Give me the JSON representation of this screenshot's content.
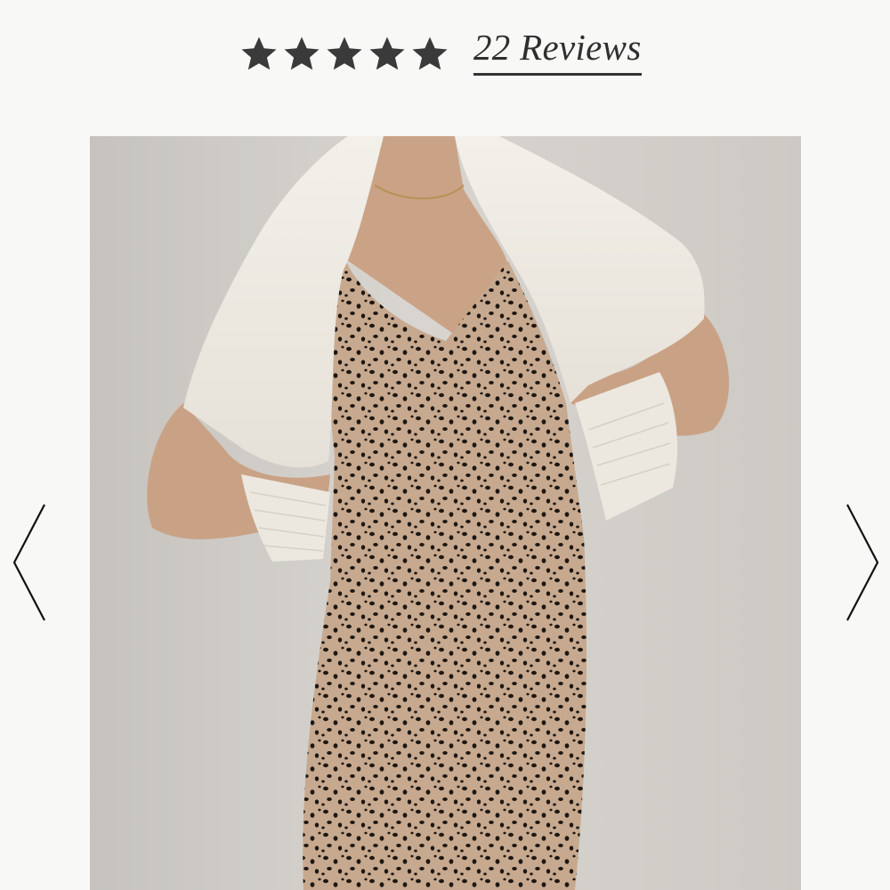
{
  "rating": {
    "stars_filled": 5,
    "stars_total": 5,
    "star_color": "#3a3a3a",
    "reviews_label": "22 Reviews"
  },
  "gallery": {
    "image_description_icon": "product-photo",
    "prev_icon": "chevron-left-icon",
    "next_icon": "chevron-right-icon",
    "arrow_color": "#111111"
  }
}
